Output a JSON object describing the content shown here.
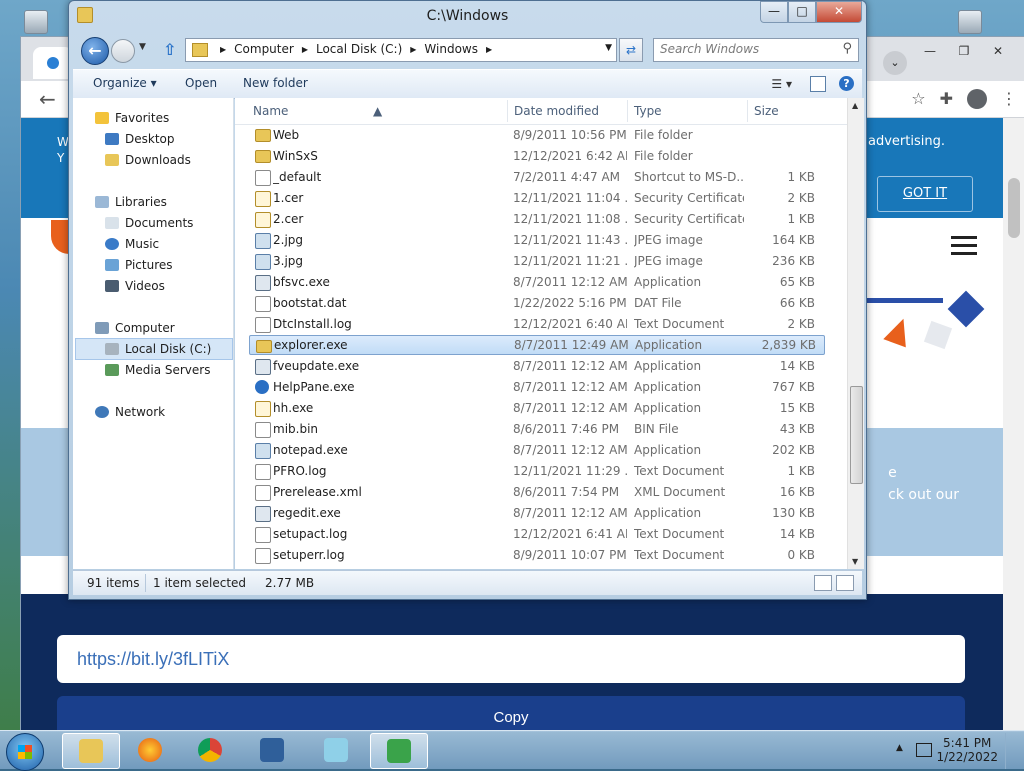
{
  "explorer": {
    "title": "C:\\Windows",
    "breadcrumbs": [
      "Computer",
      "Local Disk (C:)",
      "Windows"
    ],
    "search_placeholder": "Search Windows",
    "commands": [
      "Organize ▾",
      "Open",
      "New folder"
    ],
    "columns": [
      "Name",
      "Date modified",
      "Type",
      "Size"
    ],
    "nav": {
      "favorites_header": "Favorites",
      "favorites": [
        "Desktop",
        "Downloads"
      ],
      "libraries_header": "Libraries",
      "libraries": [
        "Documents",
        "Music",
        "Pictures",
        "Videos"
      ],
      "computer_header": "Computer",
      "computer_items": [
        "Local Disk (C:)",
        "Media Servers"
      ],
      "network_header": "Network"
    },
    "files": [
      {
        "name": "Web",
        "date": "8/9/2011 10:56 PM",
        "type": "File folder",
        "size": "",
        "icon": "folder-icon"
      },
      {
        "name": "WinSxS",
        "date": "12/12/2021 6:42 AM",
        "type": "File folder",
        "size": "",
        "icon": "folder-icon"
      },
      {
        "name": "_default",
        "date": "7/2/2011 4:47 AM",
        "type": "Shortcut to MS-D...",
        "size": "1 KB",
        "icon": "shortcut-icon"
      },
      {
        "name": "1.cer",
        "date": "12/11/2021 11:04 ...",
        "type": "Security Certificate",
        "size": "2 KB",
        "icon": "certificate-icon"
      },
      {
        "name": "2.cer",
        "date": "12/11/2021 11:08 ...",
        "type": "Security Certificate",
        "size": "1 KB",
        "icon": "certificate-icon"
      },
      {
        "name": "2.jpg",
        "date": "12/11/2021 11:43 ...",
        "type": "JPEG image",
        "size": "164 KB",
        "icon": "image-icon"
      },
      {
        "name": "3.jpg",
        "date": "12/11/2021 11:21 ...",
        "type": "JPEG image",
        "size": "236 KB",
        "icon": "image-icon"
      },
      {
        "name": "bfsvc.exe",
        "date": "8/7/2011 12:12 AM",
        "type": "Application",
        "size": "65 KB",
        "icon": "application-icon"
      },
      {
        "name": "bootstat.dat",
        "date": "1/22/2022 5:16 PM",
        "type": "DAT File",
        "size": "66 KB",
        "icon": "file-icon"
      },
      {
        "name": "DtcInstall.log",
        "date": "12/12/2021 6:40 AM",
        "type": "Text Document",
        "size": "2 KB",
        "icon": "text-document-icon"
      },
      {
        "name": "explorer.exe",
        "date": "8/7/2011 12:49 AM",
        "type": "Application",
        "size": "2,839 KB",
        "icon": "explorer-folder-icon"
      },
      {
        "name": "fveupdate.exe",
        "date": "8/7/2011 12:12 AM",
        "type": "Application",
        "size": "14 KB",
        "icon": "application-icon"
      },
      {
        "name": "HelpPane.exe",
        "date": "8/7/2011 12:12 AM",
        "type": "Application",
        "size": "767 KB",
        "icon": "help-icon"
      },
      {
        "name": "hh.exe",
        "date": "8/7/2011 12:12 AM",
        "type": "Application",
        "size": "15 KB",
        "icon": "help-file-icon"
      },
      {
        "name": "mib.bin",
        "date": "8/6/2011 7:46 PM",
        "type": "BIN File",
        "size": "43 KB",
        "icon": "file-icon"
      },
      {
        "name": "notepad.exe",
        "date": "8/7/2011 12:12 AM",
        "type": "Application",
        "size": "202 KB",
        "icon": "notepad-icon"
      },
      {
        "name": "PFRO.log",
        "date": "12/11/2021 11:29 ...",
        "type": "Text Document",
        "size": "1 KB",
        "icon": "text-document-icon"
      },
      {
        "name": "Prerelease.xml",
        "date": "8/6/2011 7:54 PM",
        "type": "XML Document",
        "size": "16 KB",
        "icon": "xml-document-icon"
      },
      {
        "name": "regedit.exe",
        "date": "8/7/2011 12:12 AM",
        "type": "Application",
        "size": "130 KB",
        "icon": "registry-icon"
      },
      {
        "name": "setupact.log",
        "date": "12/12/2021 6:41 AM",
        "type": "Text Document",
        "size": "14 KB",
        "icon": "text-document-icon"
      },
      {
        "name": "setuperr.log",
        "date": "8/9/2011 10:07 PM",
        "type": "Text Document",
        "size": "0 KB",
        "icon": "text-document-icon"
      }
    ],
    "selected_file": "explorer.exe",
    "status": {
      "count": "91 items",
      "selection": "1 item selected",
      "size": "2.77 MB"
    }
  },
  "browser": {
    "banner_text": "r advertising.",
    "banner_button": "GOT IT",
    "band_text_1": "e",
    "band_text_2": "ck out our",
    "short_url": "https://bit.ly/3fLITiX",
    "copy_button": "Copy"
  },
  "taskbar": {
    "time": "5:41 PM",
    "date": "1/22/2022",
    "pinned": [
      "windows-explorer-icon",
      "firefox-icon",
      "chrome-icon",
      "virtualbox-icon",
      "app-icon",
      "download-manager-icon"
    ]
  },
  "colors": {
    "selection_bg": "#c1dcf6",
    "banner_blue": "#1877b9",
    "navy": "#0e2a5c",
    "link_blue": "#3a6fb8"
  }
}
